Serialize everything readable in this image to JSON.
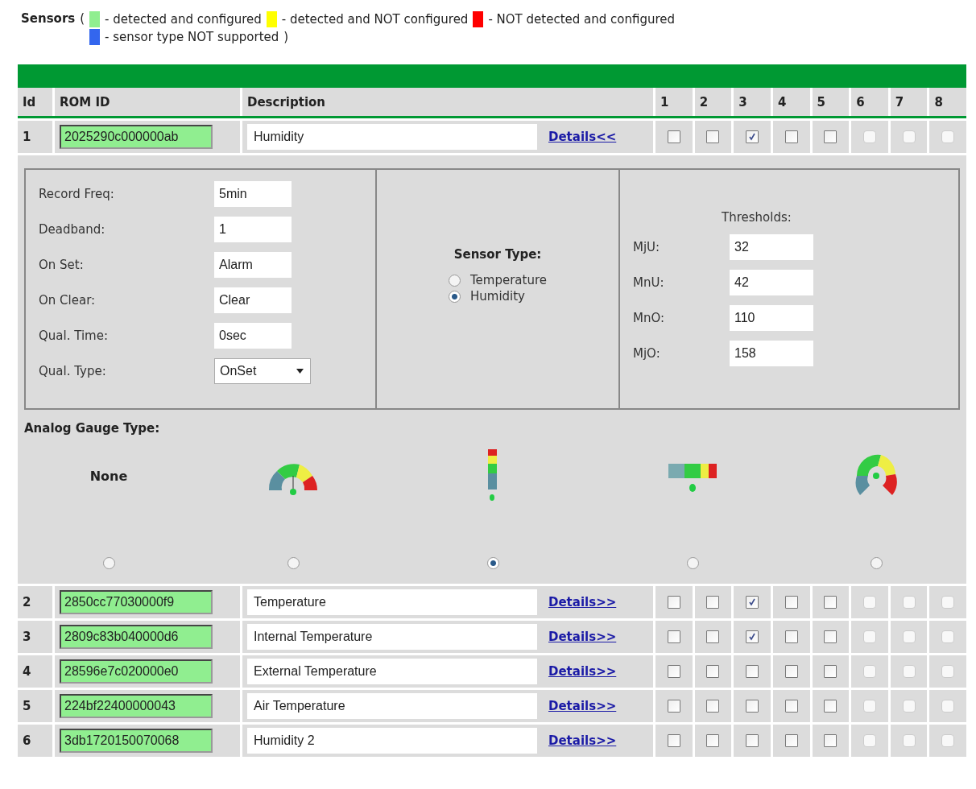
{
  "legend": {
    "title": "Sensors",
    "open": "(",
    "close": ")",
    "items": [
      {
        "color": "#90ee90",
        "text": "- detected and configured"
      },
      {
        "color": "#ffff00",
        "text": "- detected and NOT configured"
      },
      {
        "color": "#ff0000",
        "text": "- NOT detected and configured"
      },
      {
        "color": "#3366ee",
        "text": "- sensor type NOT supported"
      }
    ]
  },
  "table": {
    "columns": [
      "Id",
      "ROM ID",
      "Description",
      "1",
      "2",
      "3",
      "4",
      "5",
      "6",
      "7",
      "8"
    ],
    "rows": [
      {
        "id": "1",
        "rom_id": "2025290c000000ab",
        "description": "Humidity",
        "details": "Details<<",
        "expanded": true,
        "checks": [
          {
            "kind": "square",
            "checked": false
          },
          {
            "kind": "square",
            "checked": false
          },
          {
            "kind": "square",
            "checked": true
          },
          {
            "kind": "square",
            "checked": false
          },
          {
            "kind": "square",
            "checked": false
          },
          {
            "kind": "round",
            "checked": false
          },
          {
            "kind": "round",
            "checked": false
          },
          {
            "kind": "round",
            "checked": false
          }
        ]
      },
      {
        "id": "2",
        "rom_id": "2850cc77030000f9",
        "description": "Temperature",
        "details": "Details>>",
        "expanded": false,
        "checks": [
          {
            "kind": "square",
            "checked": false
          },
          {
            "kind": "square",
            "checked": false
          },
          {
            "kind": "square",
            "checked": true
          },
          {
            "kind": "square",
            "checked": false
          },
          {
            "kind": "square",
            "checked": false
          },
          {
            "kind": "round",
            "checked": false
          },
          {
            "kind": "round",
            "checked": false
          },
          {
            "kind": "round",
            "checked": false
          }
        ]
      },
      {
        "id": "3",
        "rom_id": "2809c83b040000d6",
        "description": "Internal Temperature",
        "details": "Details>>",
        "expanded": false,
        "checks": [
          {
            "kind": "square",
            "checked": false
          },
          {
            "kind": "square",
            "checked": false
          },
          {
            "kind": "square",
            "checked": true
          },
          {
            "kind": "square",
            "checked": false
          },
          {
            "kind": "square",
            "checked": false
          },
          {
            "kind": "round",
            "checked": false
          },
          {
            "kind": "round",
            "checked": false
          },
          {
            "kind": "round",
            "checked": false
          }
        ]
      },
      {
        "id": "4",
        "rom_id": "28596e7c020000e0",
        "description": "External Temperature",
        "details": "Details>>",
        "expanded": false,
        "checks": [
          {
            "kind": "square",
            "checked": false
          },
          {
            "kind": "square",
            "checked": false
          },
          {
            "kind": "square",
            "checked": false
          },
          {
            "kind": "square",
            "checked": false
          },
          {
            "kind": "square",
            "checked": false
          },
          {
            "kind": "round",
            "checked": false
          },
          {
            "kind": "round",
            "checked": false
          },
          {
            "kind": "round",
            "checked": false
          }
        ]
      },
      {
        "id": "5",
        "rom_id": "224bf22400000043",
        "description": "Air Temperature",
        "details": "Details>>",
        "expanded": false,
        "checks": [
          {
            "kind": "square",
            "checked": false
          },
          {
            "kind": "square",
            "checked": false
          },
          {
            "kind": "square",
            "checked": false
          },
          {
            "kind": "square",
            "checked": false
          },
          {
            "kind": "square",
            "checked": false
          },
          {
            "kind": "round",
            "checked": false
          },
          {
            "kind": "round",
            "checked": false
          },
          {
            "kind": "round",
            "checked": false
          }
        ]
      },
      {
        "id": "6",
        "rom_id": "3db1720150070068",
        "description": "Humidity 2",
        "details": "Details>>",
        "expanded": false,
        "checks": [
          {
            "kind": "square",
            "checked": false
          },
          {
            "kind": "square",
            "checked": false
          },
          {
            "kind": "square",
            "checked": false
          },
          {
            "kind": "square",
            "checked": false
          },
          {
            "kind": "square",
            "checked": false
          },
          {
            "kind": "round",
            "checked": false
          },
          {
            "kind": "round",
            "checked": false
          },
          {
            "kind": "round",
            "checked": false
          }
        ]
      }
    ]
  },
  "details": {
    "settings": [
      {
        "label": "Record Freq:",
        "value": "5min",
        "kind": "text"
      },
      {
        "label": "Deadband:",
        "value": "1",
        "kind": "text"
      },
      {
        "label": "On Set:",
        "value": "Alarm",
        "kind": "text"
      },
      {
        "label": "On Clear:",
        "value": "Clear",
        "kind": "text"
      },
      {
        "label": "Qual. Time:",
        "value": "0sec",
        "kind": "text"
      },
      {
        "label": "Qual. Type:",
        "value": "OnSet",
        "kind": "select"
      }
    ],
    "sensor_type": {
      "title": "Sensor Type:",
      "options": [
        {
          "label": "Temperature",
          "selected": false
        },
        {
          "label": "Humidity",
          "selected": true
        }
      ]
    },
    "thresholds": {
      "title": "Thresholds:",
      "items": [
        {
          "label": "MjU:",
          "value": "32"
        },
        {
          "label": "MnU:",
          "value": "42"
        },
        {
          "label": "MnO:",
          "value": "110"
        },
        {
          "label": "MjO:",
          "value": "158"
        }
      ]
    },
    "gauge": {
      "title": "Analog Gauge Type:",
      "options": [
        {
          "kind": "none",
          "label": "None",
          "selected": false
        },
        {
          "kind": "half-dial",
          "selected": false
        },
        {
          "kind": "vertical-bar",
          "selected": true
        },
        {
          "kind": "horizontal-bar",
          "selected": false
        },
        {
          "kind": "round-dial",
          "selected": false
        }
      ]
    }
  }
}
